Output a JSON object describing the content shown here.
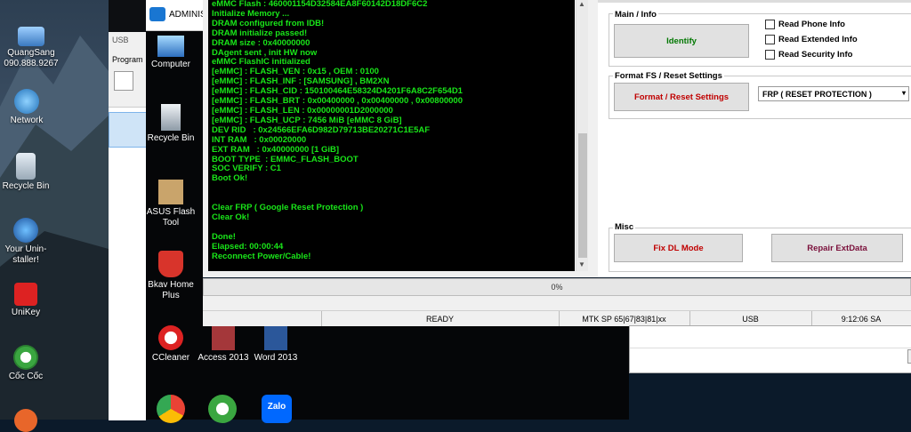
{
  "desktop_left": {
    "icons": [
      {
        "label": "QuangSang 090.888.9267",
        "icon": "computer-icon"
      },
      {
        "label": "Network",
        "icon": "network-icon"
      },
      {
        "label": "Recycle Bin",
        "icon": "recycle-bin-icon"
      },
      {
        "label": "Your Unin-staller!",
        "icon": "uninstaller-icon"
      },
      {
        "label": "UniKey",
        "icon": "unikey-icon"
      },
      {
        "label": "Cốc Cốc",
        "icon": "coccoc-icon"
      }
    ]
  },
  "behind_windows": {
    "admin_title": "ADMINIS",
    "usb_title": "USB",
    "program_label": "Program"
  },
  "desktop_inner": {
    "icons": [
      {
        "label": "Computer",
        "icon": "computer-icon"
      },
      {
        "label": "Recycle Bin",
        "icon": "recycle-bin-icon"
      },
      {
        "label": "ASUS Flash Tool",
        "icon": "asus-flash-tool-icon"
      },
      {
        "label": "Bkav Home Plus",
        "icon": "bkav-icon"
      },
      {
        "label": "CCleaner",
        "icon": "ccleaner-icon"
      },
      {
        "label": "Access 2013",
        "icon": "access-icon"
      },
      {
        "label": "Word 2013",
        "icon": "word-icon"
      }
    ]
  },
  "log": {
    "lines": [
      "eMMC Flash : 460001154D32584EA8F60142D18DF6C2",
      "Initialize Memory ...",
      "DRAM configured from IDB!",
      "DRAM initialize passed!",
      "DRAM size : 0x40000000",
      "DAgent sent , init HW now",
      "eMMC FlashIC initialized",
      "[eMMC] : FLASH_VEN : 0x15 , OEM : 0100",
      "[eMMC] : FLASH_INF : [SAMSUNG] , BM2XN",
      "[eMMC] : FLASH_CID : 150100464E58324D4201F6A8C2F654D1",
      "[eMMC] : FLASH_BRT : 0x00400000 , 0x00400000 , 0x00800000",
      "[eMMC] : FLASH_LEN : 0x00000001D2000000",
      "[eMMC] : FLASH_UCP : 7456 MiB [eMMC 8 GiB]",
      "DEV RID   : 0x24566EFA6D982D79713BE20271C1E5AF",
      "INT RAM   : 0x00020000",
      "EXT RAM   : 0x40000000 [1 GiB]",
      "BOOT TYPE  : EMMC_FLASH_BOOT",
      "SOC VERIFY : C1",
      "Boot Ok!",
      "",
      "",
      "Clear FRP ( Google Reset Protection )",
      "Clear Ok!",
      "",
      "Done!",
      "Elapsed: 00:00:44",
      "Reconnect Power/Cable!"
    ]
  },
  "panel": {
    "main_info_title": "Main / Info",
    "identify_label": "Identify",
    "read_phone_info": "Read Phone Info",
    "read_extended_info": "Read Extended Info",
    "read_security_info": "Read Security Info",
    "format_title": "Format FS / Reset Settings",
    "format_button": "Format / Reset Settings",
    "format_select": "FRP ( RESET PROTECTION )",
    "misc_title": "Misc",
    "fix_dl_mode": "Fix DL Mode",
    "repair_extdata": "Repair ExtData"
  },
  "progress": {
    "text": "0%",
    "value": 0
  },
  "status": {
    "state": "READY",
    "platform": "MTK SP 65|67|83|81|xx",
    "port": "USB",
    "time": "9:12:06 SA"
  },
  "colors": {
    "log_text": "#19e619",
    "red_button_text": "#c00000",
    "green_button_text": "#007700",
    "purple_button_text": "#7a0f3a"
  }
}
